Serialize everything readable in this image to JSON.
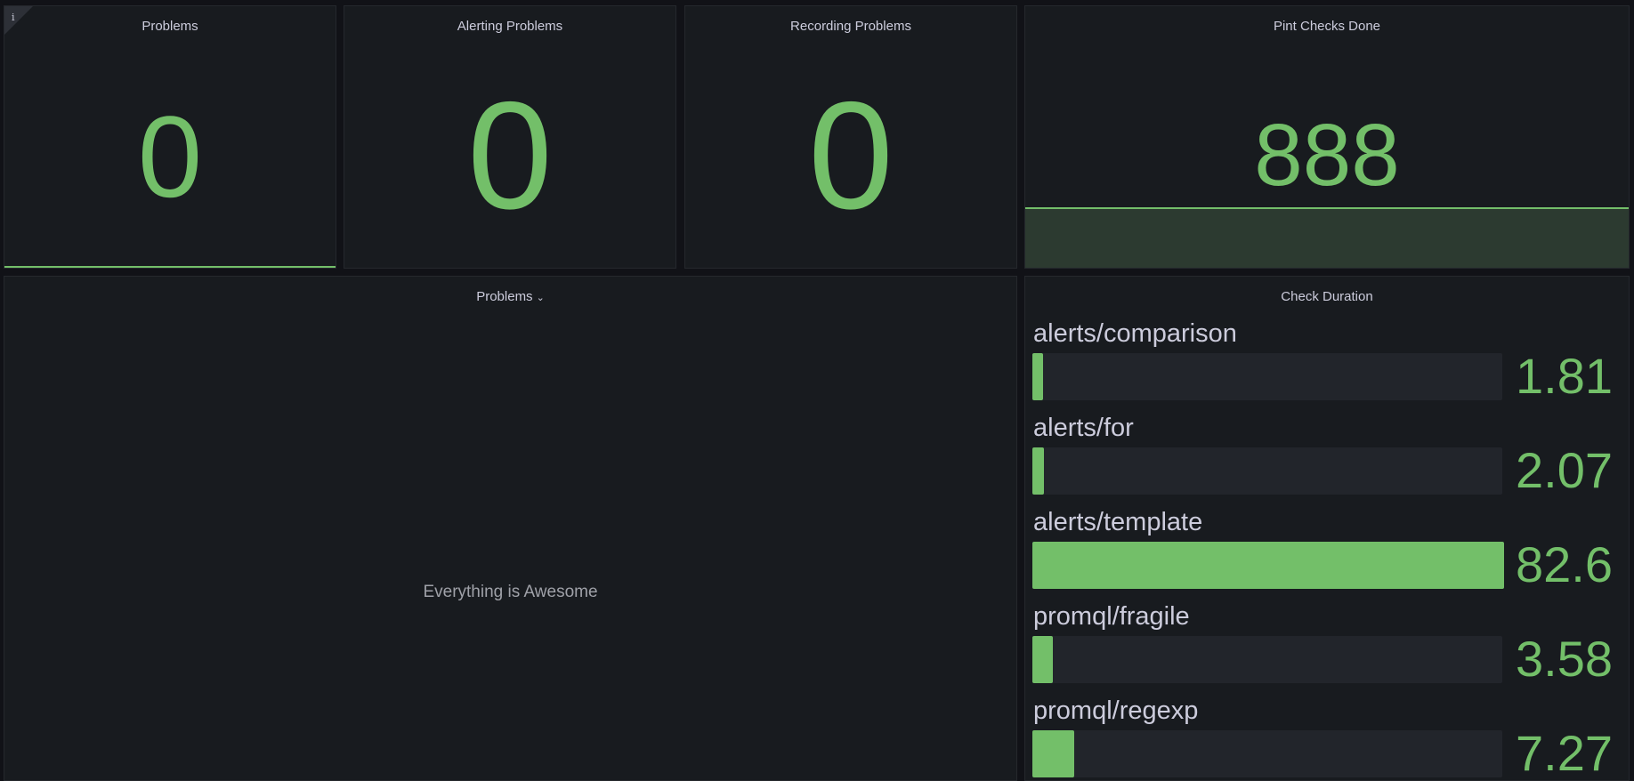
{
  "colors": {
    "accent": "#73bf69",
    "panel_bg": "#181b1f",
    "text": "#ccccdc"
  },
  "stats": [
    {
      "title": "Problems",
      "value": "0",
      "info_icon": "info-icon"
    },
    {
      "title": "Alerting Problems",
      "value": "0"
    },
    {
      "title": "Recording Problems",
      "value": "0"
    },
    {
      "title": "Pint Checks Done",
      "value": "888"
    }
  ],
  "problems_panel": {
    "title": "Problems",
    "menu_icon": "chevron-down-icon",
    "empty_message": "Everything is Awesome"
  },
  "check_duration": {
    "title": "Check Duration",
    "max": 82.6,
    "rows": [
      {
        "label": "alerts/comparison",
        "value": 1.81,
        "display": "1.81"
      },
      {
        "label": "alerts/for",
        "value": 2.07,
        "display": "2.07"
      },
      {
        "label": "alerts/template",
        "value": 82.6,
        "display": "82.6"
      },
      {
        "label": "promql/fragile",
        "value": 3.58,
        "display": "3.58"
      },
      {
        "label": "promql/regexp",
        "value": 7.27,
        "display": "7.27"
      }
    ]
  }
}
